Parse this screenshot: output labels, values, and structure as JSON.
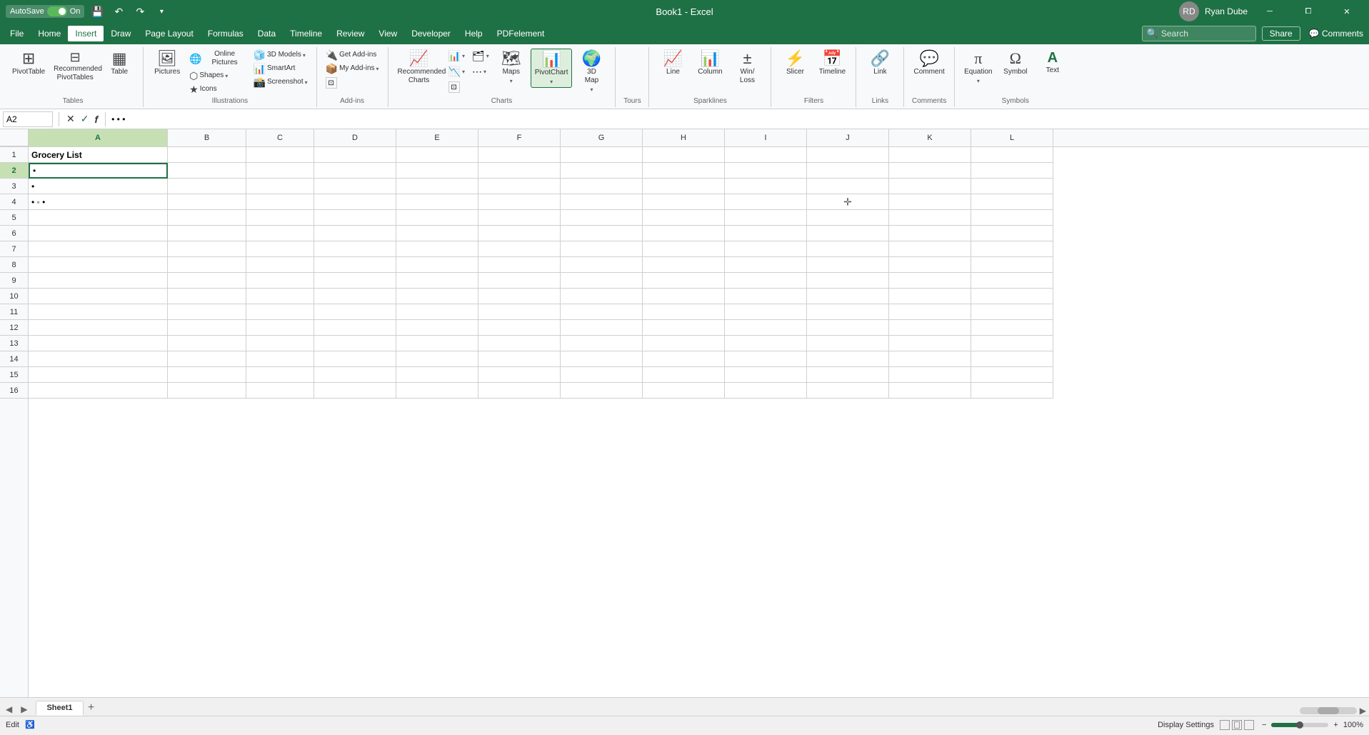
{
  "titlebar": {
    "autosave_label": "AutoSave",
    "autosave_state": "On",
    "filename": "Book1",
    "app_name": "Excel",
    "title": "Book1 - Excel",
    "user": "Ryan Dube",
    "save_icon": "💾",
    "undo_icon": "↶",
    "redo_icon": "↷",
    "customize_icon": "▾",
    "minimize": "─",
    "restore": "⧠",
    "close": "✕"
  },
  "menubar": {
    "items": [
      "File",
      "Home",
      "Insert",
      "Draw",
      "Page Layout",
      "Formulas",
      "Data",
      "Timeline",
      "Review",
      "View",
      "Developer",
      "Help",
      "PDFelement"
    ]
  },
  "ribbon": {
    "active_tab": "Insert",
    "groups": [
      {
        "name": "Tables",
        "label": "Tables",
        "buttons": [
          {
            "id": "pivot-table",
            "label": "PivotTable",
            "icon": "⊞"
          },
          {
            "id": "recommended-pivot",
            "label": "Recommended\nPivotTables",
            "icon": "⊟"
          },
          {
            "id": "table",
            "label": "Table",
            "icon": "▦"
          }
        ]
      },
      {
        "name": "Illustrations",
        "label": "Illustrations",
        "buttons": [
          {
            "id": "pictures",
            "label": "Pictures",
            "icon": "🖼"
          },
          {
            "id": "online-pictures",
            "label": "Online Pictures",
            "icon": "🌐"
          },
          {
            "id": "shapes",
            "label": "Shapes",
            "icon": "⬡"
          },
          {
            "id": "icons",
            "label": "Icons",
            "icon": "★"
          },
          {
            "id": "3d-models",
            "label": "3D Models",
            "icon": "🧊"
          },
          {
            "id": "smartart",
            "label": "SmartArt",
            "icon": "📊"
          },
          {
            "id": "screenshot",
            "label": "Screenshot",
            "icon": "📸"
          }
        ]
      },
      {
        "name": "Add-ins",
        "label": "Add-ins",
        "buttons": [
          {
            "id": "get-addins",
            "label": "Get Add-ins",
            "icon": "🔌"
          },
          {
            "id": "my-addins",
            "label": "My Add-ins",
            "icon": "📦"
          }
        ]
      },
      {
        "name": "Charts",
        "label": "Charts",
        "buttons": [
          {
            "id": "recommended-charts",
            "label": "Recommended\nCharts",
            "icon": "📈"
          },
          {
            "id": "column-bar",
            "label": "",
            "icon": "📊"
          },
          {
            "id": "hierarchy",
            "label": "",
            "icon": "🗂"
          },
          {
            "id": "statistic",
            "label": "",
            "icon": "📉"
          },
          {
            "id": "scatter",
            "label": "",
            "icon": "⋯"
          },
          {
            "id": "maps",
            "label": "Maps",
            "icon": "🗺"
          },
          {
            "id": "pivot-chart",
            "label": "PivotChart",
            "icon": "📊"
          },
          {
            "id": "3d-map",
            "label": "3D\nMap",
            "icon": "🌍"
          }
        ]
      },
      {
        "name": "Tours",
        "label": "Tours",
        "buttons": []
      },
      {
        "name": "Sparklines",
        "label": "Sparklines",
        "buttons": [
          {
            "id": "line",
            "label": "Line",
            "icon": "📈"
          },
          {
            "id": "column",
            "label": "Column",
            "icon": "📊"
          },
          {
            "id": "win-loss",
            "label": "Win/\nLoss",
            "icon": "±"
          }
        ]
      },
      {
        "name": "Filters",
        "label": "Filters",
        "buttons": [
          {
            "id": "slicer",
            "label": "Slicer",
            "icon": "⚡"
          },
          {
            "id": "timeline",
            "label": "Timeline",
            "icon": "📅"
          }
        ]
      },
      {
        "name": "Links",
        "label": "Links",
        "buttons": [
          {
            "id": "link",
            "label": "Link",
            "icon": "🔗"
          }
        ]
      },
      {
        "name": "Comments",
        "label": "Comments",
        "buttons": [
          {
            "id": "comment",
            "label": "Comment",
            "icon": "💬"
          }
        ]
      },
      {
        "name": "Symbols",
        "label": "Symbols",
        "buttons": [
          {
            "id": "equation",
            "label": "Equation",
            "icon": "π"
          },
          {
            "id": "symbol",
            "label": "Symbol",
            "icon": "Ω"
          },
          {
            "id": "text",
            "label": "Text",
            "icon": "A"
          }
        ]
      }
    ],
    "search_placeholder": "Search",
    "share_label": "Share",
    "comments_label": "Comments"
  },
  "formula_bar": {
    "cell_ref": "A2",
    "cancel_icon": "✕",
    "confirm_icon": "✓",
    "function_icon": "f",
    "formula_value": "• • •"
  },
  "spreadsheet": {
    "columns": [
      "A",
      "B",
      "C",
      "D",
      "E",
      "F",
      "G",
      "H",
      "I",
      "J",
      "K",
      "L"
    ],
    "rows": [
      1,
      2,
      3,
      4,
      5,
      6,
      7,
      8,
      9,
      10,
      11,
      12,
      13,
      14,
      15,
      16
    ],
    "active_cell": "A2",
    "selected_col": "A",
    "data": {
      "A1": "Grocery List",
      "A2": "•",
      "A3": "•",
      "A4": "•"
    }
  },
  "sheet_tabs": {
    "tabs": [
      "Sheet1"
    ],
    "active": "Sheet1",
    "add_label": "+"
  },
  "status_bar": {
    "mode": "Edit",
    "accessibility": "♿",
    "display_settings": "Display Settings",
    "zoom": "100%"
  }
}
